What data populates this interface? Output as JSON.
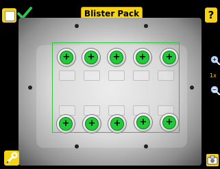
{
  "header": {
    "title": "Blister Pack",
    "help_label": "?"
  },
  "zoom": {
    "level_label": "1x"
  },
  "inspection": {
    "status": "pass",
    "pill_marker": "+",
    "pill_count": 10,
    "colors": {
      "accent": "#f5d315",
      "pass": "#24c83a",
      "roi": "#26c43a"
    }
  },
  "icons": {
    "menu": "menu-icon",
    "pass": "checkmark-icon",
    "help": "help-icon",
    "zoom_in": "zoom-in-icon",
    "zoom_out": "zoom-out-icon",
    "tools": "wrench-icon",
    "camera": "camera-icon"
  }
}
